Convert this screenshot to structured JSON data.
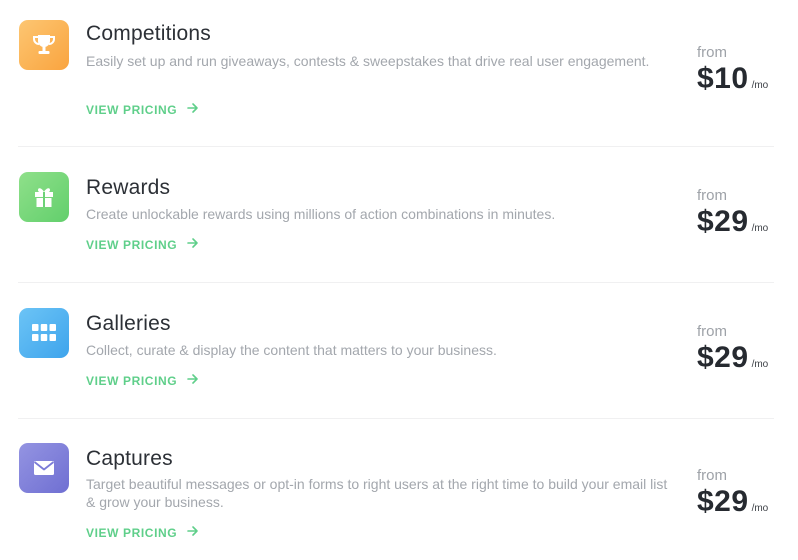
{
  "products": [
    {
      "title": "Competitions",
      "description": "Easily set up and run giveaways, contests & sweepstakes that drive real user engagement.",
      "cta": "VIEW PRICING",
      "from_label": "from",
      "price": "$10",
      "period": "/mo",
      "icon": "trophy-icon"
    },
    {
      "title": "Rewards",
      "description": "Create unlockable rewards using millions of action combinations in minutes.",
      "cta": "VIEW PRICING",
      "from_label": "from",
      "price": "$29",
      "period": "/mo",
      "icon": "gift-icon"
    },
    {
      "title": "Galleries",
      "description": "Collect, curate & display the content that matters to your business.",
      "cta": "VIEW PRICING",
      "from_label": "from",
      "price": "$29",
      "period": "/mo",
      "icon": "grid-icon"
    },
    {
      "title": "Captures",
      "description": "Target beautiful messages or opt-in forms to right users at the right time to build your email list & grow your business.",
      "cta": "VIEW PRICING",
      "from_label": "from",
      "price": "$29",
      "period": "/mo",
      "icon": "envelope-icon"
    }
  ],
  "colors": {
    "accent_green": "#5fcf8a",
    "competitions_icon": "#fcb95b",
    "rewards_icon": "#7fdb73",
    "galleries_icon": "#5cb6f2",
    "captures_icon": "#8383dc"
  }
}
